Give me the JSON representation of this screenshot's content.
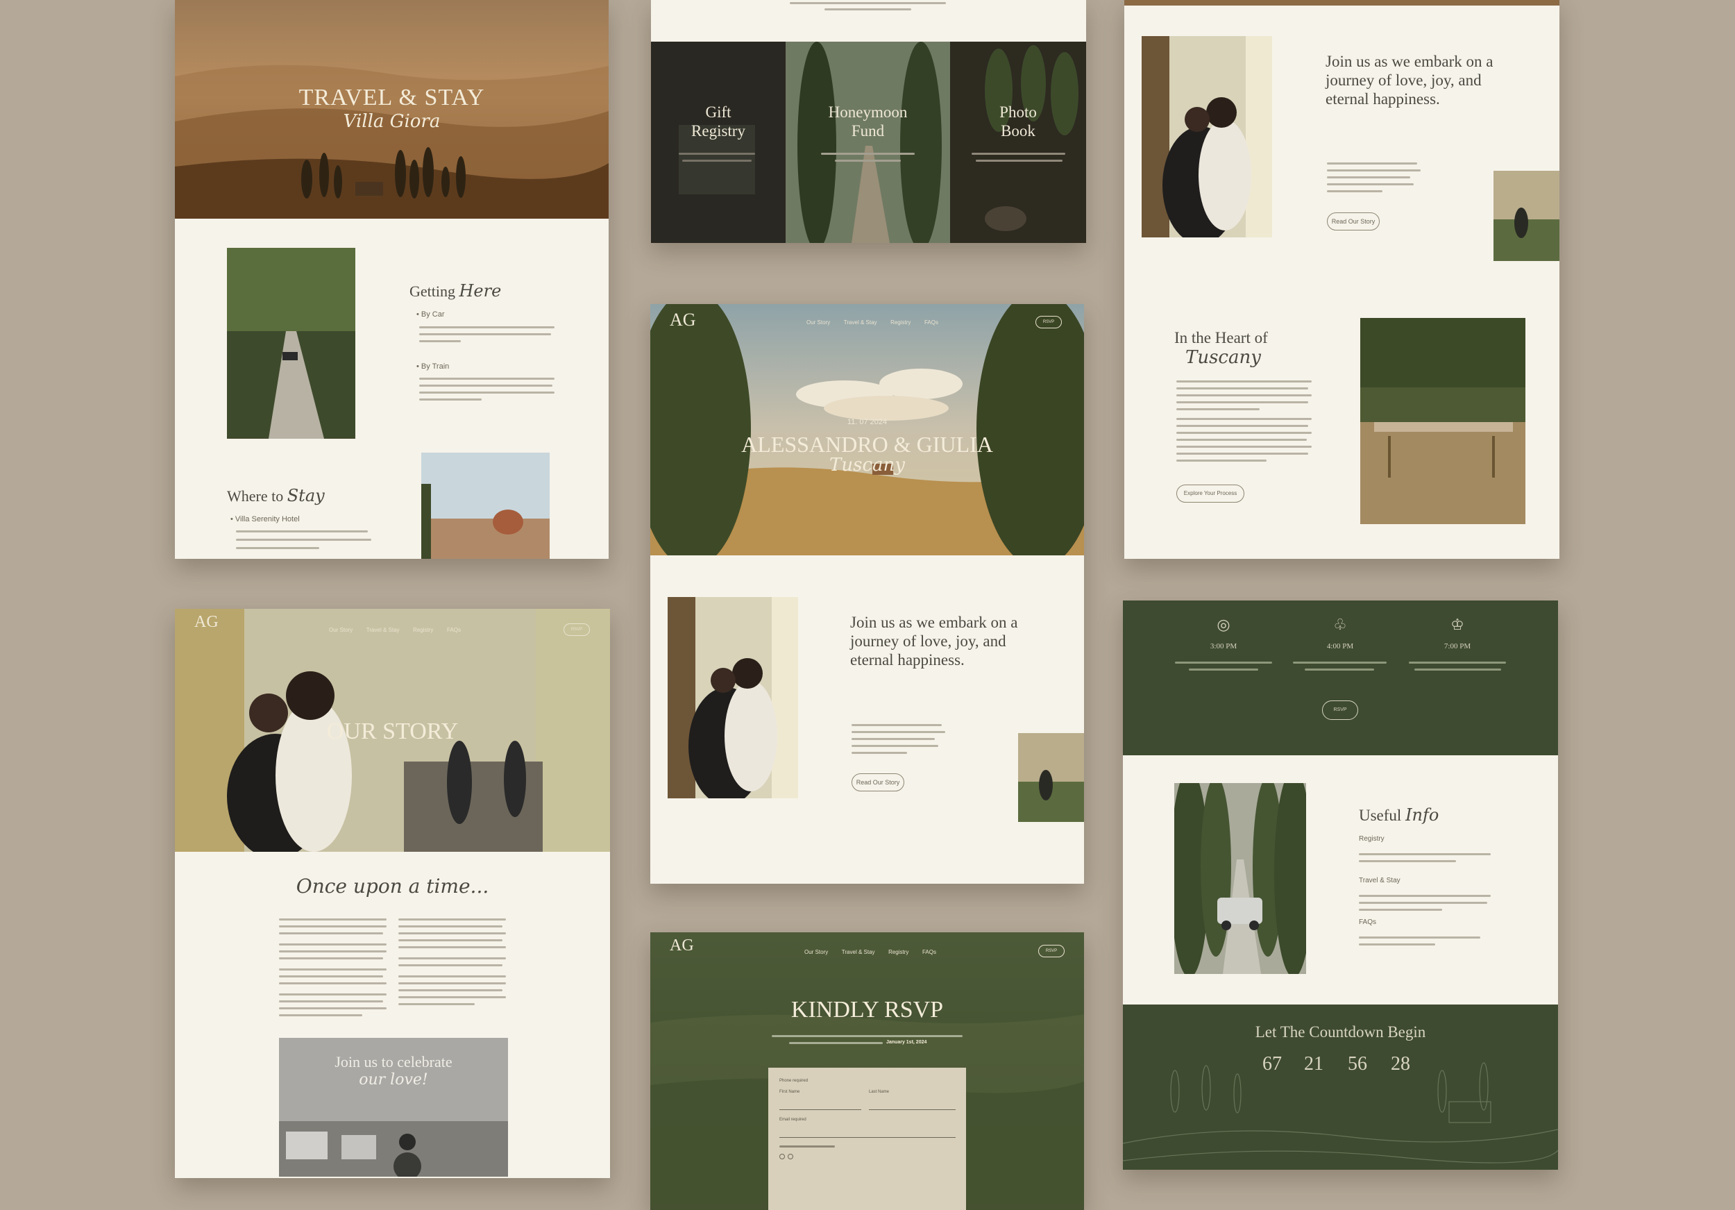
{
  "monogram": "AG",
  "nav": {
    "items": [
      "Our Story",
      "Travel & Stay",
      "Registry",
      "FAQs"
    ],
    "rsvp": "RSVP"
  },
  "travel_page": {
    "hero_title": "TRAVEL & STAY",
    "hero_script": "Villa Giora",
    "getting_title": "Getting",
    "getting_script": "Here",
    "by_car": "• By Car",
    "by_train": "• By Train",
    "where_title": "Where to",
    "where_script": "Stay",
    "hotel": "• Villa Serenity Hotel"
  },
  "registry_page": {
    "panels": [
      {
        "title_1": "Gift",
        "title_2": "Registry"
      },
      {
        "title_1": "Honeymoon",
        "title_2": "Fund"
      },
      {
        "title_1": "Photo",
        "title_2": "Book"
      }
    ]
  },
  "story_page_right": {
    "headline": "Join us as we embark on a journey of love, joy, and eternal happiness.",
    "read_btn": "Read Our Story",
    "heart_title": "In the Heart of",
    "heart_script": "Tuscany",
    "explore_btn": "Explore Your Process"
  },
  "home_page": {
    "date": "11. 07 2024",
    "names": "ALESSANDRO & GIULIA",
    "script": "Tuscany",
    "headline": "Join us as we embark on a journey of love, joy, and eternal happiness.",
    "read_btn": "Read Our Story"
  },
  "our_story_page": {
    "hero_title": "OUR STORY",
    "script_heading": "Once upon a time...",
    "celebrate_title": "Join us to celebrate",
    "celebrate_script": "our love!"
  },
  "schedule_page": {
    "times": [
      "3:00 PM",
      "4:00 PM",
      "7:00 PM"
    ],
    "rsvp_btn": "RSVP",
    "useful_title": "Useful",
    "useful_script": "Info",
    "items": [
      "Registry",
      "Travel & Stay",
      "FAQs"
    ],
    "countdown_title": "Let The Countdown Begin",
    "countdown": [
      "67",
      "21",
      "56",
      "28"
    ]
  },
  "rsvp_page": {
    "title": "KINDLY RSVP",
    "deadline": "January 1st, 2024",
    "phone_label": "Phone required",
    "first_name": "First Name",
    "last_name": "Last Name",
    "email_label": "Email required"
  }
}
